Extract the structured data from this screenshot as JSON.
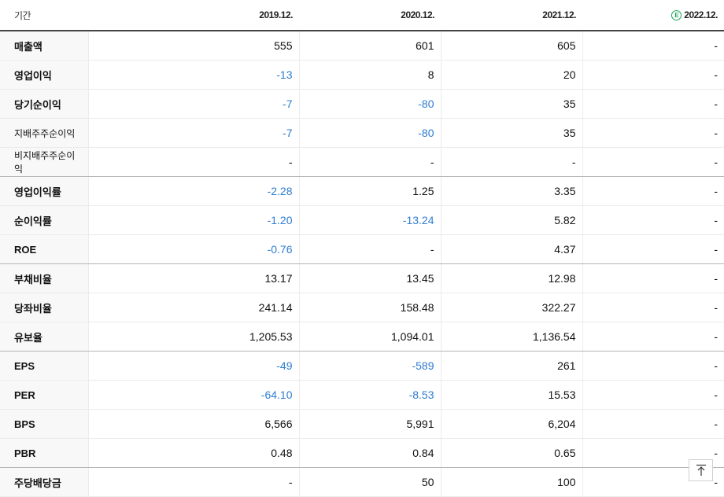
{
  "header": {
    "period_label": "기간",
    "columns": [
      "2019.12.",
      "2020.12.",
      "2021.12.",
      "2022.12."
    ],
    "estimate_badge": "E"
  },
  "rows": [
    {
      "label": "매출액",
      "small": false,
      "values": [
        "555",
        "601",
        "605",
        "-"
      ]
    },
    {
      "label": "영업이익",
      "small": false,
      "values": [
        "-13",
        "8",
        "20",
        "-"
      ]
    },
    {
      "label": "당기순이익",
      "small": false,
      "values": [
        "-7",
        "-80",
        "35",
        "-"
      ]
    },
    {
      "label": "지배주주순이익",
      "small": true,
      "values": [
        "-7",
        "-80",
        "35",
        "-"
      ]
    },
    {
      "label": "비지배주주순이익",
      "small": true,
      "values": [
        "-",
        "-",
        "-",
        "-"
      ]
    },
    {
      "label": "영업이익률",
      "small": false,
      "values": [
        "-2.28",
        "1.25",
        "3.35",
        "-"
      ]
    },
    {
      "label": "순이익률",
      "small": false,
      "values": [
        "-1.20",
        "-13.24",
        "5.82",
        "-"
      ]
    },
    {
      "label": "ROE",
      "small": false,
      "values": [
        "-0.76",
        "-",
        "4.37",
        "-"
      ]
    },
    {
      "label": "부채비율",
      "small": false,
      "values": [
        "13.17",
        "13.45",
        "12.98",
        "-"
      ]
    },
    {
      "label": "당좌비율",
      "small": false,
      "values": [
        "241.14",
        "158.48",
        "322.27",
        "-"
      ]
    },
    {
      "label": "유보율",
      "small": false,
      "values": [
        "1,205.53",
        "1,094.01",
        "1,136.54",
        "-"
      ]
    },
    {
      "label": "EPS",
      "small": false,
      "values": [
        "-49",
        "-589",
        "261",
        "-"
      ]
    },
    {
      "label": "PER",
      "small": false,
      "values": [
        "-64.10",
        "-8.53",
        "15.53",
        "-"
      ]
    },
    {
      "label": "BPS",
      "small": false,
      "values": [
        "6,566",
        "5,991",
        "6,204",
        "-"
      ]
    },
    {
      "label": "PBR",
      "small": false,
      "values": [
        "0.48",
        "0.84",
        "0.65",
        "-"
      ]
    },
    {
      "label": "주당배당금",
      "small": false,
      "values": [
        "-",
        "50",
        "100",
        "-"
      ]
    }
  ],
  "colors": {
    "negative": "#2f7dd1",
    "estimate": "#1aa35a"
  },
  "scroll_top_icon": "arrow-up-to-top-icon"
}
